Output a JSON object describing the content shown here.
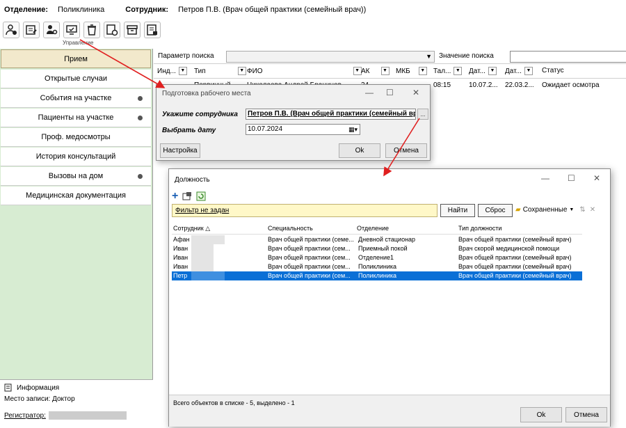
{
  "topbar": {
    "department_label": "Отделение:",
    "department_value": "Поликлиника",
    "employee_label": "Сотрудник:",
    "employee_value": "Петров П.В. (Врач общей практики (семейный врач))"
  },
  "toolbar": {
    "group_label": "Управление",
    "icons": [
      "user-add-icon",
      "card-edit-icon",
      "users-manage-icon",
      "monitor-check-icon",
      "trash-icon",
      "page-add-icon",
      "archive-icon",
      "document-list-icon"
    ]
  },
  "sidebar": {
    "items": [
      {
        "label": "Прием",
        "active": true,
        "dot": false
      },
      {
        "label": "Открытые случаи",
        "active": false,
        "dot": false
      },
      {
        "label": "События на участке",
        "active": false,
        "dot": true
      },
      {
        "label": "Пациенты на участке",
        "active": false,
        "dot": true
      },
      {
        "label": "Проф. медосмотры",
        "active": false,
        "dot": false
      },
      {
        "label": "История консультаций",
        "active": false,
        "dot": false
      },
      {
        "label": "Вызовы на дом",
        "active": false,
        "dot": true
      },
      {
        "label": "Медицинская документация",
        "active": false,
        "dot": false
      }
    ],
    "info_label": "Информация",
    "workplace": "Место записи: Доктор",
    "registrar_label": "Регистратор:"
  },
  "search": {
    "param_label": "Параметр поиска",
    "value_label": "Значение поиска",
    "param_value": "",
    "value_value": ""
  },
  "grid": {
    "columns": [
      "Инд...",
      "Тип",
      "ФИО",
      "АК",
      "МКБ",
      "Тал...",
      "Дат...",
      "Дат...",
      "Статус"
    ],
    "row": [
      "",
      "Первичный",
      "Николаева Андрей Браницов",
      "24...",
      "",
      "08:15",
      "10.07.2...",
      "22.03.2...",
      "Ожидает осмотра"
    ]
  },
  "dialog_workplace": {
    "title": "Подготовка рабочего места",
    "employee_label": "Укажите сотрудника",
    "employee_value": "Петров П.В. (Врач общей практики (семейный врач))",
    "date_label": "Выбрать дату",
    "date_value": "10.07.2024",
    "settings_button": "Настройка",
    "ok_button": "Ok",
    "cancel_button": "Отмена",
    "browse_button": "..."
  },
  "dialog_position": {
    "title": "Должность",
    "filter_text": "Фильтр не задан",
    "find_button": "Найти",
    "reset_button": "Сброс",
    "saved_label": "Сохраненные",
    "columns": [
      "Сотрудник",
      "Специальность",
      "Отделение",
      "Тип должности"
    ],
    "rows": [
      {
        "employee": "Афан",
        "specialty": "Врач общей практики (семе...",
        "department": "Дневной стационар",
        "type": "Врач общей практики (семейный врач)",
        "selected": false
      },
      {
        "employee": "Иван",
        "specialty": "Врач общей практики (сем...",
        "department": "Приемный покой",
        "type": "Врач скорой медицинской помощи",
        "selected": false
      },
      {
        "employee": "Иван",
        "specialty": "Врач общей практики (сем...",
        "department": "Отделение1",
        "type": "Врач общей практики (семейный врач)",
        "selected": false
      },
      {
        "employee": "Иван",
        "specialty": "Врач общей практики (сем...",
        "department": "Поликлиника",
        "type": "Врач общей практики (семейный врач)",
        "selected": false
      },
      {
        "employee": "Петр",
        "specialty": "Врач общей практики (сем...",
        "department": "Поликлиника",
        "type": "Врач общей практики (семейный врач)",
        "selected": true
      }
    ],
    "status": "Всего объектов в списке - 5, выделено - 1",
    "ok_button": "Ok",
    "cancel_button": "Отмена"
  },
  "colors": {
    "sidebar_bg": "#d7ecd2",
    "active_item": "#f2e9cc",
    "selection": "#0a6fd6",
    "filter_bg": "#fff8c8",
    "arrow": "#e02020"
  }
}
